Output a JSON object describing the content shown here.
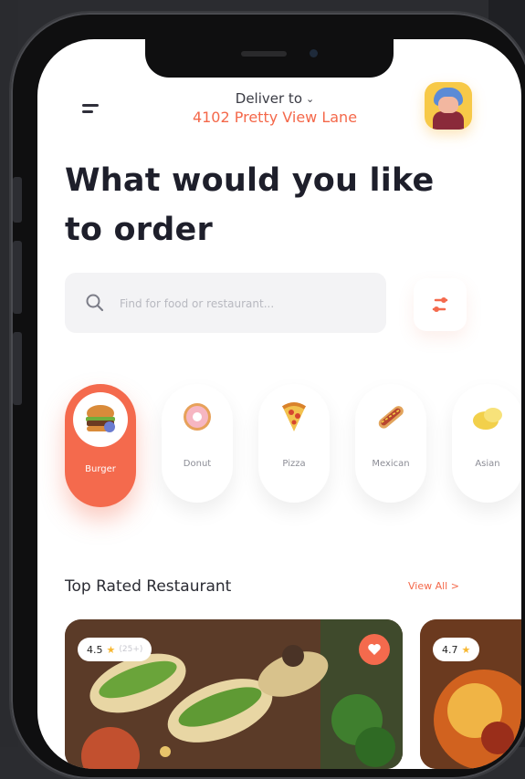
{
  "header": {
    "deliver_label": "Deliver to",
    "address": "4102 Pretty View Lane"
  },
  "headline": "What would you like to order",
  "search": {
    "placeholder": "Find for food or restaurant..."
  },
  "categories": [
    {
      "label": "Burger",
      "icon": "burger-icon",
      "active": true
    },
    {
      "label": "Donut",
      "icon": "donut-icon",
      "active": false
    },
    {
      "label": "Pizza",
      "icon": "pizza-icon",
      "active": false
    },
    {
      "label": "Mexican",
      "icon": "hotdog-icon",
      "active": false
    },
    {
      "label": "Asian",
      "icon": "asian-food-icon",
      "active": false
    }
  ],
  "section": {
    "title": "Top Rated Restaurant",
    "view_all": "View All >"
  },
  "restaurants": [
    {
      "rating": "4.5",
      "count": "(25+)",
      "image": "tacos-photo"
    },
    {
      "rating": "4.7",
      "count": "",
      "image": "dish-photo"
    }
  ],
  "colors": {
    "accent": "#f46a4d",
    "heading": "#1e1f2b",
    "star": "#f7b731"
  }
}
